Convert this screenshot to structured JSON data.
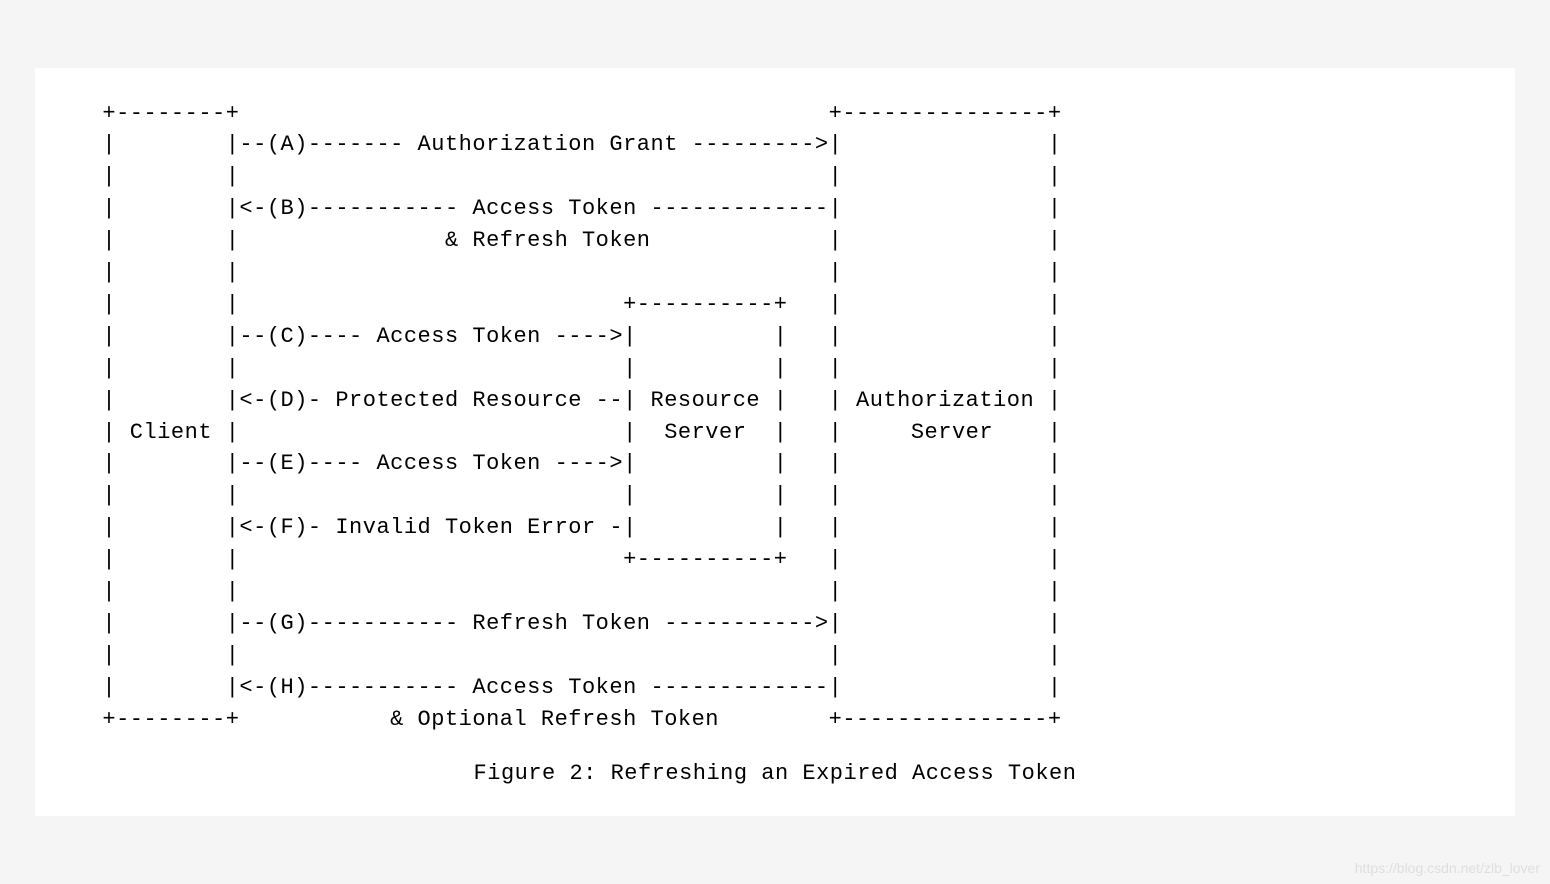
{
  "diagram": {
    "lines": [
      "  +--------+                                           +---------------+",
      "  |        |--(A)------- Authorization Grant --------->|               |",
      "  |        |                                           |               |",
      "  |        |<-(B)----------- Access Token -------------|               |",
      "  |        |               & Refresh Token             |               |",
      "  |        |                                           |               |",
      "  |        |                            +----------+   |               |",
      "  |        |--(C)---- Access Token ---->|          |   |               |",
      "  |        |                            |          |   |               |",
      "  |        |<-(D)- Protected Resource --| Resource |   | Authorization |",
      "  | Client |                            |  Server  |   |     Server    |",
      "  |        |--(E)---- Access Token ---->|          |   |               |",
      "  |        |                            |          |   |               |",
      "  |        |<-(F)- Invalid Token Error -|          |   |               |",
      "  |        |                            +----------+   |               |",
      "  |        |                                           |               |",
      "  |        |--(G)----------- Refresh Token ----------->|               |",
      "  |        |                                           |               |",
      "  |        |<-(H)----------- Access Token -------------|               |",
      "  +--------+           & Optional Refresh Token        +---------------+"
    ],
    "caption": "Figure 2: Refreshing an Expired Access Token"
  },
  "entities": {
    "client": "Client",
    "resource_server": "Resource Server",
    "authorization_server": "Authorization Server"
  },
  "flows": [
    {
      "step": "A",
      "direction": "right",
      "from": "Client",
      "to": "Authorization Server",
      "label": "Authorization Grant"
    },
    {
      "step": "B",
      "direction": "left",
      "from": "Authorization Server",
      "to": "Client",
      "label": "Access Token & Refresh Token"
    },
    {
      "step": "C",
      "direction": "right",
      "from": "Client",
      "to": "Resource Server",
      "label": "Access Token"
    },
    {
      "step": "D",
      "direction": "left",
      "from": "Resource Server",
      "to": "Client",
      "label": "Protected Resource"
    },
    {
      "step": "E",
      "direction": "right",
      "from": "Client",
      "to": "Resource Server",
      "label": "Access Token"
    },
    {
      "step": "F",
      "direction": "left",
      "from": "Resource Server",
      "to": "Client",
      "label": "Invalid Token Error"
    },
    {
      "step": "G",
      "direction": "right",
      "from": "Client",
      "to": "Authorization Server",
      "label": "Refresh Token"
    },
    {
      "step": "H",
      "direction": "left",
      "from": "Authorization Server",
      "to": "Client",
      "label": "Access Token & Optional Refresh Token"
    }
  ],
  "watermark": "https://blog.csdn.net/zlb_lover"
}
